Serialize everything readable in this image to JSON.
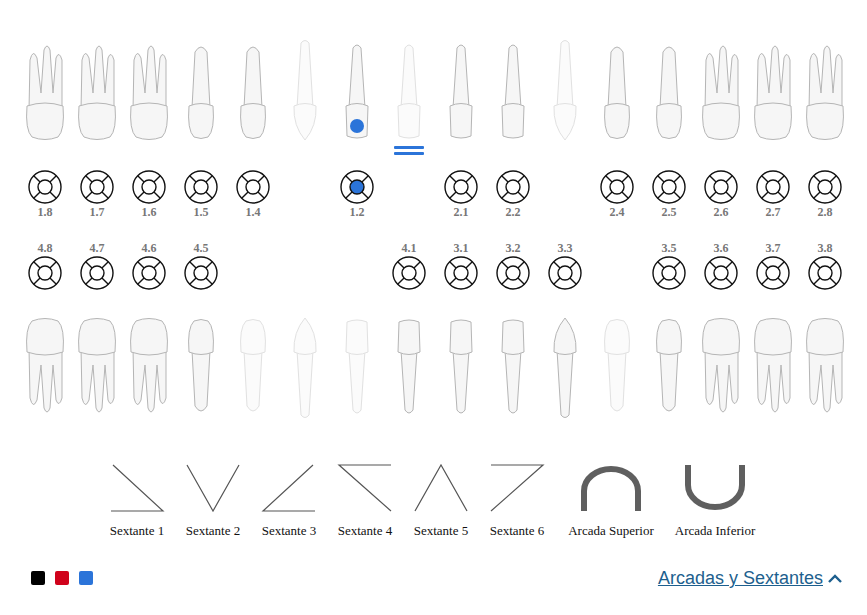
{
  "upper_teeth": [
    {
      "label": "1.8",
      "kind": "molar",
      "absent": false,
      "marked": false,
      "center_filled": false,
      "double_line": false
    },
    {
      "label": "1.7",
      "kind": "molar",
      "absent": false,
      "marked": false,
      "center_filled": false,
      "double_line": false
    },
    {
      "label": "1.6",
      "kind": "molar",
      "absent": false,
      "marked": false,
      "center_filled": false,
      "double_line": false
    },
    {
      "label": "1.5",
      "kind": "premolar",
      "absent": false,
      "marked": false,
      "center_filled": false,
      "double_line": false
    },
    {
      "label": "1.4",
      "kind": "premolar",
      "absent": false,
      "marked": false,
      "center_filled": false,
      "double_line": false
    },
    {
      "kind": "canine",
      "absent": true,
      "marked": false,
      "center_filled": false,
      "double_line": false
    },
    {
      "label": "1.2",
      "kind": "incisor",
      "absent": false,
      "marked": true,
      "center_filled": true,
      "double_line": false
    },
    {
      "kind": "incisor",
      "absent": true,
      "marked": false,
      "center_filled": false,
      "double_line": true
    },
    {
      "label": "2.1",
      "kind": "incisor",
      "absent": false,
      "marked": false,
      "center_filled": false,
      "double_line": false
    },
    {
      "label": "2.2",
      "kind": "incisor",
      "absent": false,
      "marked": false,
      "center_filled": false,
      "double_line": false
    },
    {
      "kind": "canine",
      "absent": true,
      "marked": false,
      "center_filled": false,
      "double_line": false
    },
    {
      "label": "2.4",
      "kind": "premolar",
      "absent": false,
      "marked": false,
      "center_filled": false,
      "double_line": false
    },
    {
      "label": "2.5",
      "kind": "premolar",
      "absent": false,
      "marked": false,
      "center_filled": false,
      "double_line": false
    },
    {
      "label": "2.6",
      "kind": "molar",
      "absent": false,
      "marked": false,
      "center_filled": false,
      "double_line": false
    },
    {
      "label": "2.7",
      "kind": "molar",
      "absent": false,
      "marked": false,
      "center_filled": false,
      "double_line": false
    },
    {
      "label": "2.8",
      "kind": "molar",
      "absent": false,
      "marked": false,
      "center_filled": false,
      "double_line": false
    }
  ],
  "lower_teeth": [
    {
      "label": "4.8",
      "kind": "molar",
      "absent": false,
      "marked": false,
      "center_filled": false,
      "double_line": false
    },
    {
      "label": "4.7",
      "kind": "molar",
      "absent": false,
      "marked": false,
      "center_filled": false,
      "double_line": false
    },
    {
      "label": "4.6",
      "kind": "molar",
      "absent": false,
      "marked": false,
      "center_filled": false,
      "double_line": false
    },
    {
      "label": "4.5",
      "kind": "premolar",
      "absent": false,
      "marked": false,
      "center_filled": false,
      "double_line": false
    },
    {
      "kind": "premolar",
      "absent": true,
      "marked": false,
      "center_filled": false,
      "double_line": false
    },
    {
      "kind": "canine",
      "absent": true,
      "marked": false,
      "center_filled": false,
      "double_line": false
    },
    {
      "kind": "incisor",
      "absent": true,
      "marked": false,
      "center_filled": false,
      "double_line": false
    },
    {
      "label": "4.1",
      "kind": "incisor",
      "absent": false,
      "marked": false,
      "center_filled": false,
      "double_line": false
    },
    {
      "label": "3.1",
      "kind": "incisor",
      "absent": false,
      "marked": false,
      "center_filled": false,
      "double_line": false
    },
    {
      "label": "3.2",
      "kind": "incisor",
      "absent": false,
      "marked": false,
      "center_filled": false,
      "double_line": false
    },
    {
      "label": "3.3",
      "kind": "canine",
      "absent": false,
      "marked": false,
      "center_filled": false,
      "double_line": false
    },
    {
      "kind": "premolar",
      "absent": true,
      "marked": false,
      "center_filled": false,
      "double_line": false
    },
    {
      "label": "3.5",
      "kind": "premolar",
      "absent": false,
      "marked": false,
      "center_filled": false,
      "double_line": false
    },
    {
      "label": "3.6",
      "kind": "molar",
      "absent": false,
      "marked": false,
      "center_filled": false,
      "double_line": false
    },
    {
      "label": "3.7",
      "kind": "molar",
      "absent": false,
      "marked": false,
      "center_filled": false,
      "double_line": false
    },
    {
      "label": "3.8",
      "kind": "molar",
      "absent": false,
      "marked": false,
      "center_filled": false,
      "double_line": false
    }
  ],
  "sextants": [
    {
      "label": "Sextante 1",
      "kind": "s1"
    },
    {
      "label": "Sextante 2",
      "kind": "s2"
    },
    {
      "label": "Sextante 3",
      "kind": "s3"
    },
    {
      "label": "Sextante 4",
      "kind": "s4"
    },
    {
      "label": "Sextante 5",
      "kind": "s5"
    },
    {
      "label": "Sextante 6",
      "kind": "s6"
    },
    {
      "label": "Arcada Superior",
      "kind": "upper"
    },
    {
      "label": "Arcada Inferior",
      "kind": "lower"
    }
  ],
  "palette": [
    {
      "color": "#000000"
    },
    {
      "color": "#d0021b"
    },
    {
      "color": "#2b74d9"
    }
  ],
  "toggle": {
    "label": "Arcadas y Sextantes",
    "expanded": true
  }
}
